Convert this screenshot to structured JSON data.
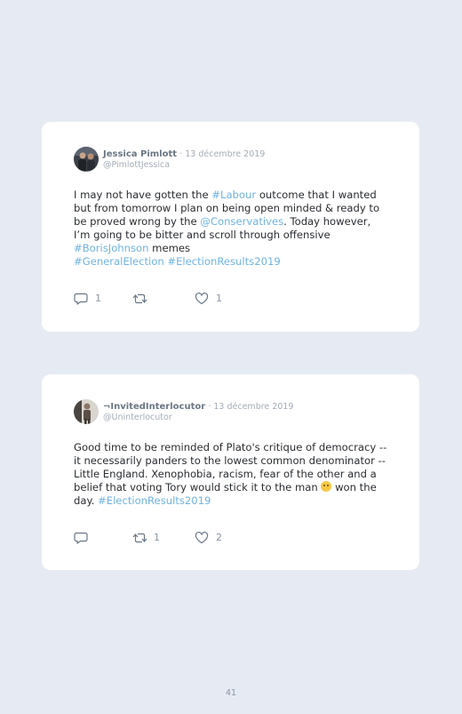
{
  "tweets": [
    {
      "name": "Jessica Pimlott",
      "date": "· 13 décembre 2019",
      "handle": "@PimlottJessica",
      "text": [
        {
          "t": "I may not have gotten the "
        },
        {
          "t": "#Labour",
          "link": true
        },
        {
          "t": " outcome that I wanted but from tomorrow I plan on being open minded & ready to be proved wrong by the "
        },
        {
          "t": "@Conservatives",
          "link": true
        },
        {
          "t": ". Today however, I’m going to be bitter and scroll through offensive "
        },
        {
          "t": "#BorisJohnson",
          "link": true
        },
        {
          "t": " memes "
        },
        {
          "br": true
        },
        {
          "t": "#GeneralElection",
          "link": true
        },
        {
          "t": " "
        },
        {
          "t": "#ElectionResults2019",
          "link": true
        }
      ],
      "replies": "1",
      "retweets": "",
      "likes": "1"
    },
    {
      "name": "¬InvitedInterlocutor",
      "date": "· 13 décembre 2019",
      "handle": "@Uninterlocutor",
      "text": [
        {
          "t": "Good time to be reminded of Plato's critique of democracy -- it necessarily panders to the lowest common denominator -- Little England. Xenophobia, racism, fear of the other and a belief that voting Tory would stick it to the man "
        },
        {
          "emoji": "confused-face-emoji"
        },
        {
          "t": " won the day. "
        },
        {
          "t": "#ElectionResults2019",
          "link": true
        }
      ],
      "replies": "",
      "retweets": "1",
      "likes": "2"
    }
  ],
  "page_number": "41",
  "colors": {
    "background": "#e6ebf3",
    "link": "#6fb3e0",
    "muted": "#a4adb7"
  },
  "icons": [
    "reply-icon",
    "retweet-icon",
    "heart-icon"
  ]
}
